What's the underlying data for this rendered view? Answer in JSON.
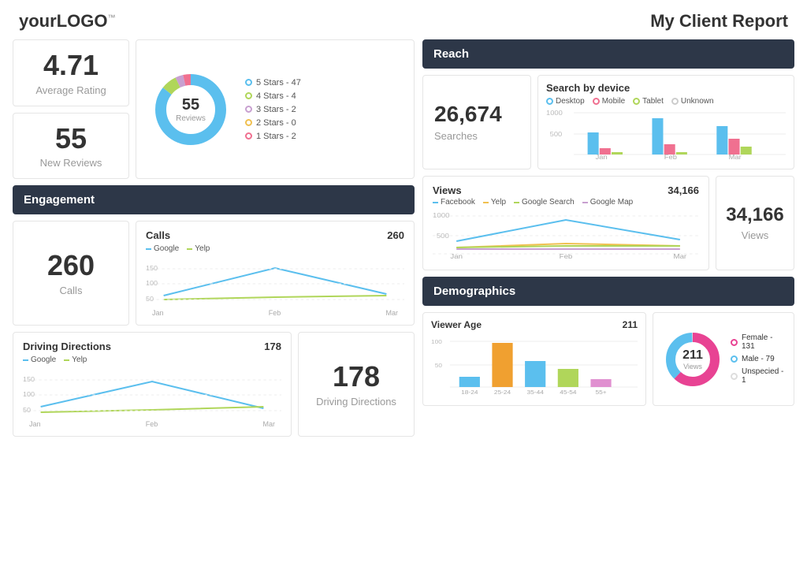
{
  "header": {
    "logo_text": "your",
    "logo_bold": "LOGO",
    "logo_tm": "™",
    "report_title": "My Client Report"
  },
  "stats": {
    "average_rating": "4.71",
    "average_rating_label": "Average Rating",
    "new_reviews": "55",
    "new_reviews_label": "New Reviews",
    "reviews_total": "55",
    "reviews_center_label": "Reviews",
    "searches": "26,674",
    "searches_label": "Searches",
    "views": "34,166",
    "views_label": "Views",
    "calls": "260",
    "calls_label": "Calls",
    "driving_directions": "178",
    "driving_directions_label": "Driving Directions",
    "viewer_age_total": "211",
    "views_total": "34,166",
    "gender_total": "211",
    "gender_label": "Views"
  },
  "sections": {
    "reach": "Reach",
    "engagement": "Engagement",
    "demographics": "Demographics"
  },
  "reviews_legend": [
    {
      "label": "5 Stars - 47",
      "color": "#5bbfee"
    },
    {
      "label": "4 Stars - 4",
      "color": "#b0d65a"
    },
    {
      "label": "3 Stars - 2",
      "color": "#c8a0d0"
    },
    {
      "label": "2 Stars - 0",
      "color": "#f0c050"
    },
    {
      "label": "1 Stars - 2",
      "color": "#f07090"
    }
  ],
  "chart_labels": {
    "calls_title": "Calls",
    "calls_number": "260",
    "calls_google": "Google",
    "calls_yelp": "Yelp",
    "directions_title": "Driving Directions",
    "directions_number": "178",
    "directions_google": "Google",
    "directions_yelp": "Yelp",
    "views_title": "Views",
    "views_number": "34,166",
    "views_facebook": "Facebook",
    "views_yelp": "Yelp",
    "views_google_search": "Google Search",
    "views_google_map": "Google Map",
    "device_title": "Search by device",
    "device_desktop": "Desktop",
    "device_mobile": "Mobile",
    "device_tablet": "Tablet",
    "device_unknown": "Unknown",
    "viewer_age_title": "Viewer Age",
    "viewer_age_total": "211"
  },
  "months": [
    "Jan",
    "Feb",
    "Mar"
  ],
  "age_groups": [
    "18-24",
    "25-24",
    "35-44",
    "45-54",
    "55+"
  ],
  "gender_legend": [
    {
      "label": "Female - 131",
      "color": "#e84393"
    },
    {
      "label": "Male - 79",
      "color": "#5bbfee"
    },
    {
      "label": "Unspecied - 1",
      "color": "#ddd"
    }
  ]
}
